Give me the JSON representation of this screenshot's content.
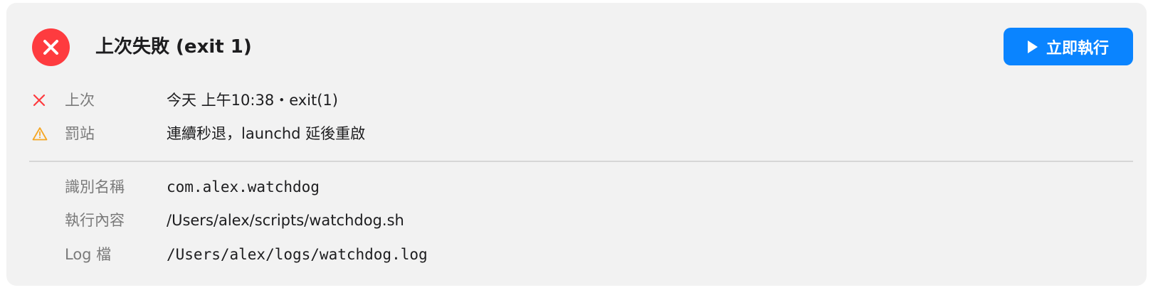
{
  "header": {
    "title": "上次失敗 (exit 1)",
    "status_icon": "x-circle-icon",
    "run_button_label": "立即執行",
    "run_button_icon": "play-icon"
  },
  "status_rows": [
    {
      "icon": "x-icon",
      "label": "上次",
      "value": "今天 上午10:38・exit(1)"
    },
    {
      "icon": "warning-icon",
      "label": "罰站",
      "value": "連續秒退，launchd 延後重啟"
    }
  ],
  "detail_rows": [
    {
      "label": "識別名稱",
      "value": "com.alex.watchdog"
    },
    {
      "label": "執行內容",
      "value": "/Users/alex/scripts/watchdog.sh"
    },
    {
      "label": "Log 檔",
      "value": "/Users/alex/logs/watchdog.log"
    }
  ],
  "colors": {
    "error": "#fe3b3f",
    "warning": "#f5a623",
    "accent": "#0a84ff",
    "card_background": "#f2f2f2"
  }
}
